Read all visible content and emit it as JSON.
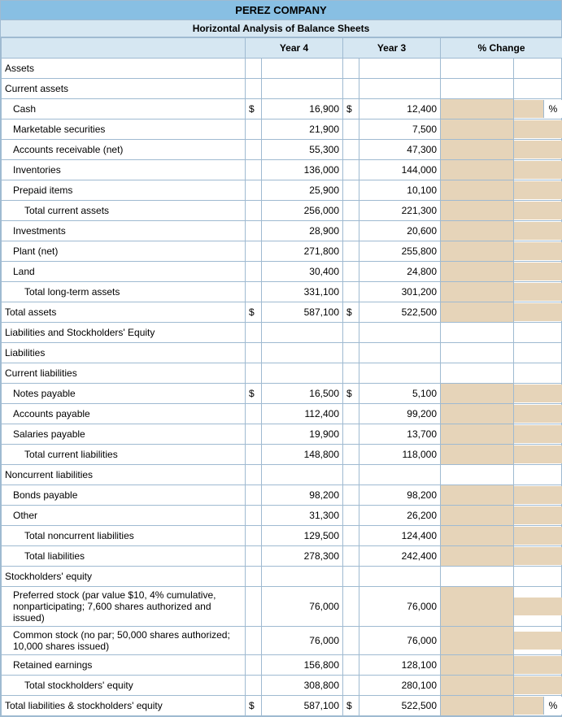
{
  "title": "PEREZ COMPANY",
  "subtitle": "Horizontal Analysis of Balance Sheets",
  "headers": {
    "year4": "Year 4",
    "year3": "Year 3",
    "pct": "% Change"
  },
  "pct_symbol": "%",
  "curr_symbol": "$",
  "rows": [
    {
      "label": "Assets",
      "indent": 0,
      "y4": "",
      "y4c": "",
      "y3": "",
      "y3c": "",
      "inp": false,
      "pct": false
    },
    {
      "label": "Current assets",
      "indent": 0,
      "y4": "",
      "y4c": "",
      "y3": "",
      "y3c": "",
      "inp": false,
      "pct": false
    },
    {
      "label": "Cash",
      "indent": 1,
      "y4c": "$",
      "y4": "16,900",
      "y3c": "$",
      "y3": "12,400",
      "inp": true,
      "pct": true
    },
    {
      "label": "Marketable securities",
      "indent": 1,
      "y4c": "",
      "y4": "21,900",
      "y3c": "",
      "y3": "7,500",
      "inp": true,
      "pct": false
    },
    {
      "label": "Accounts receivable (net)",
      "indent": 1,
      "y4c": "",
      "y4": "55,300",
      "y3c": "",
      "y3": "47,300",
      "inp": true,
      "pct": false
    },
    {
      "label": "Inventories",
      "indent": 1,
      "y4c": "",
      "y4": "136,000",
      "y3c": "",
      "y3": "144,000",
      "inp": true,
      "pct": false
    },
    {
      "label": "Prepaid items",
      "indent": 1,
      "y4c": "",
      "y4": "25,900",
      "y3c": "",
      "y3": "10,100",
      "inp": true,
      "pct": false
    },
    {
      "label": "Total current assets",
      "indent": 2,
      "y4c": "",
      "y4": "256,000",
      "y3c": "",
      "y3": "221,300",
      "inp": true,
      "pct": false
    },
    {
      "label": "Investments",
      "indent": 1,
      "y4c": "",
      "y4": "28,900",
      "y3c": "",
      "y3": "20,600",
      "inp": true,
      "pct": false
    },
    {
      "label": "Plant (net)",
      "indent": 1,
      "y4c": "",
      "y4": "271,800",
      "y3c": "",
      "y3": "255,800",
      "inp": true,
      "pct": false
    },
    {
      "label": "Land",
      "indent": 1,
      "y4c": "",
      "y4": "30,400",
      "y3c": "",
      "y3": "24,800",
      "inp": true,
      "pct": false
    },
    {
      "label": "Total long-term assets",
      "indent": 2,
      "y4c": "",
      "y4": "331,100",
      "y3c": "",
      "y3": "301,200",
      "inp": true,
      "pct": false
    },
    {
      "label": "Total assets",
      "indent": 0,
      "y4c": "$",
      "y4": "587,100",
      "y3c": "$",
      "y3": "522,500",
      "inp": true,
      "pct": false
    },
    {
      "label": "Liabilities and Stockholders' Equity",
      "indent": 0,
      "y4": "",
      "y4c": "",
      "y3": "",
      "y3c": "",
      "inp": false,
      "pct": false
    },
    {
      "label": "Liabilities",
      "indent": 0,
      "y4": "",
      "y4c": "",
      "y3": "",
      "y3c": "",
      "inp": false,
      "pct": false
    },
    {
      "label": "Current liabilities",
      "indent": 0,
      "y4": "",
      "y4c": "",
      "y3": "",
      "y3c": "",
      "inp": false,
      "pct": false
    },
    {
      "label": "Notes payable",
      "indent": 1,
      "y4c": "$",
      "y4": "16,500",
      "y3c": "$",
      "y3": "5,100",
      "inp": true,
      "pct": false
    },
    {
      "label": "Accounts payable",
      "indent": 1,
      "y4c": "",
      "y4": "112,400",
      "y3c": "",
      "y3": "99,200",
      "inp": true,
      "pct": false
    },
    {
      "label": "Salaries payable",
      "indent": 1,
      "y4c": "",
      "y4": "19,900",
      "y3c": "",
      "y3": "13,700",
      "inp": true,
      "pct": false
    },
    {
      "label": "Total current liabilities",
      "indent": 2,
      "y4c": "",
      "y4": "148,800",
      "y3c": "",
      "y3": "118,000",
      "inp": true,
      "pct": false
    },
    {
      "label": "Noncurrent liabilities",
      "indent": 0,
      "y4": "",
      "y4c": "",
      "y3": "",
      "y3c": "",
      "inp": false,
      "pct": false
    },
    {
      "label": "Bonds payable",
      "indent": 1,
      "y4c": "",
      "y4": "98,200",
      "y3c": "",
      "y3": "98,200",
      "inp": true,
      "pct": false
    },
    {
      "label": "Other",
      "indent": 1,
      "y4c": "",
      "y4": "31,300",
      "y3c": "",
      "y3": "26,200",
      "inp": true,
      "pct": false
    },
    {
      "label": "Total noncurrent liabilities",
      "indent": 2,
      "y4c": "",
      "y4": "129,500",
      "y3c": "",
      "y3": "124,400",
      "inp": true,
      "pct": false
    },
    {
      "label": "Total liabilities",
      "indent": 2,
      "y4c": "",
      "y4": "278,300",
      "y3c": "",
      "y3": "242,400",
      "inp": true,
      "pct": false
    },
    {
      "label": "Stockholders' equity",
      "indent": 0,
      "y4": "",
      "y4c": "",
      "y3": "",
      "y3c": "",
      "inp": false,
      "pct": false
    },
    {
      "label": "Preferred stock (par value $10, 4% cumulative, nonparticipating; 7,600 shares authorized and issued)",
      "indent": 1,
      "y4c": "",
      "y4": "76,000",
      "y3c": "",
      "y3": "76,000",
      "inp": true,
      "pct": false
    },
    {
      "label": "Common stock (no par; 50,000 shares authorized; 10,000 shares issued)",
      "indent": 1,
      "y4c": "",
      "y4": "76,000",
      "y3c": "",
      "y3": "76,000",
      "inp": true,
      "pct": false
    },
    {
      "label": "Retained earnings",
      "indent": 1,
      "y4c": "",
      "y4": "156,800",
      "y3c": "",
      "y3": "128,100",
      "inp": true,
      "pct": false
    },
    {
      "label": "Total stockholders' equity",
      "indent": 2,
      "y4c": "",
      "y4": "308,800",
      "y3c": "",
      "y3": "280,100",
      "inp": true,
      "pct": false
    },
    {
      "label": "Total liabilities & stockholders' equity",
      "indent": 0,
      "y4c": "$",
      "y4": "587,100",
      "y3c": "$",
      "y3": "522,500",
      "inp": true,
      "pct": true
    }
  ]
}
